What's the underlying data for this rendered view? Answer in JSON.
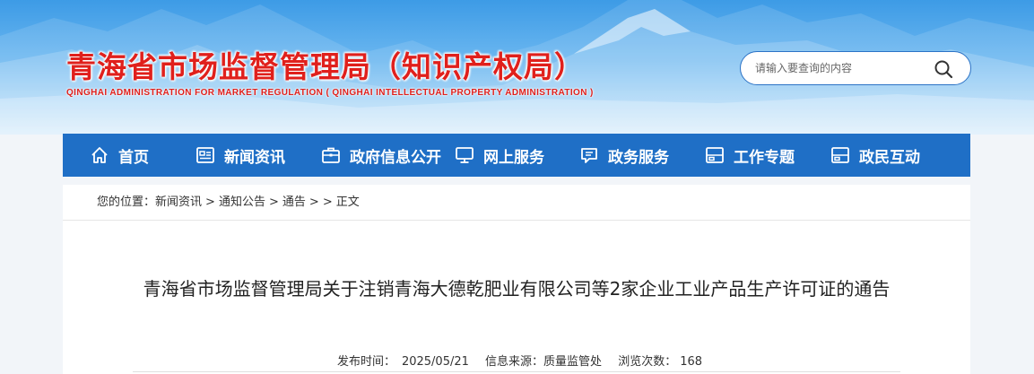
{
  "header": {
    "title": "青海省市场监督管理局（知识产权局）",
    "subtitle": "QINGHAI ADMINISTRATION FOR MARKET REGULATION ( QINGHAI INTELLECTUAL PROPERTY ADMINISTRATION )"
  },
  "search": {
    "placeholder": "请输入要查询的内容",
    "icon": "search-icon"
  },
  "nav": {
    "items": [
      {
        "label": "首页",
        "icon": "home-icon"
      },
      {
        "label": "新闻资讯",
        "icon": "news-icon"
      },
      {
        "label": "政府信息公开",
        "icon": "briefcase-icon"
      },
      {
        "label": "网上服务",
        "icon": "monitor-icon"
      },
      {
        "label": "政务服务",
        "icon": "chat-icon"
      },
      {
        "label": "工作专题",
        "icon": "grid-icon"
      },
      {
        "label": "政民互动",
        "icon": "grid-icon"
      }
    ]
  },
  "breadcrumb": {
    "prefix": "您的位置：",
    "items": [
      "新闻资讯",
      "通知公告",
      "通告",
      "正文"
    ],
    "sep": ">",
    "sep_last": "> >"
  },
  "article": {
    "title": "青海省市场监督管理局关于注销青海大德乾肥业有限公司等2家企业工业产品生产许可证的通告",
    "publish_label": "发布时间：",
    "publish_date": "2025/05/21",
    "source_label": "信息来源：",
    "source": "质量监管处",
    "views_label": "浏览次数：",
    "views": "168"
  },
  "colors": {
    "brand_red": "#e0201c",
    "nav_blue": "#1f6fc6",
    "sky_blue": "#3d9be6"
  }
}
